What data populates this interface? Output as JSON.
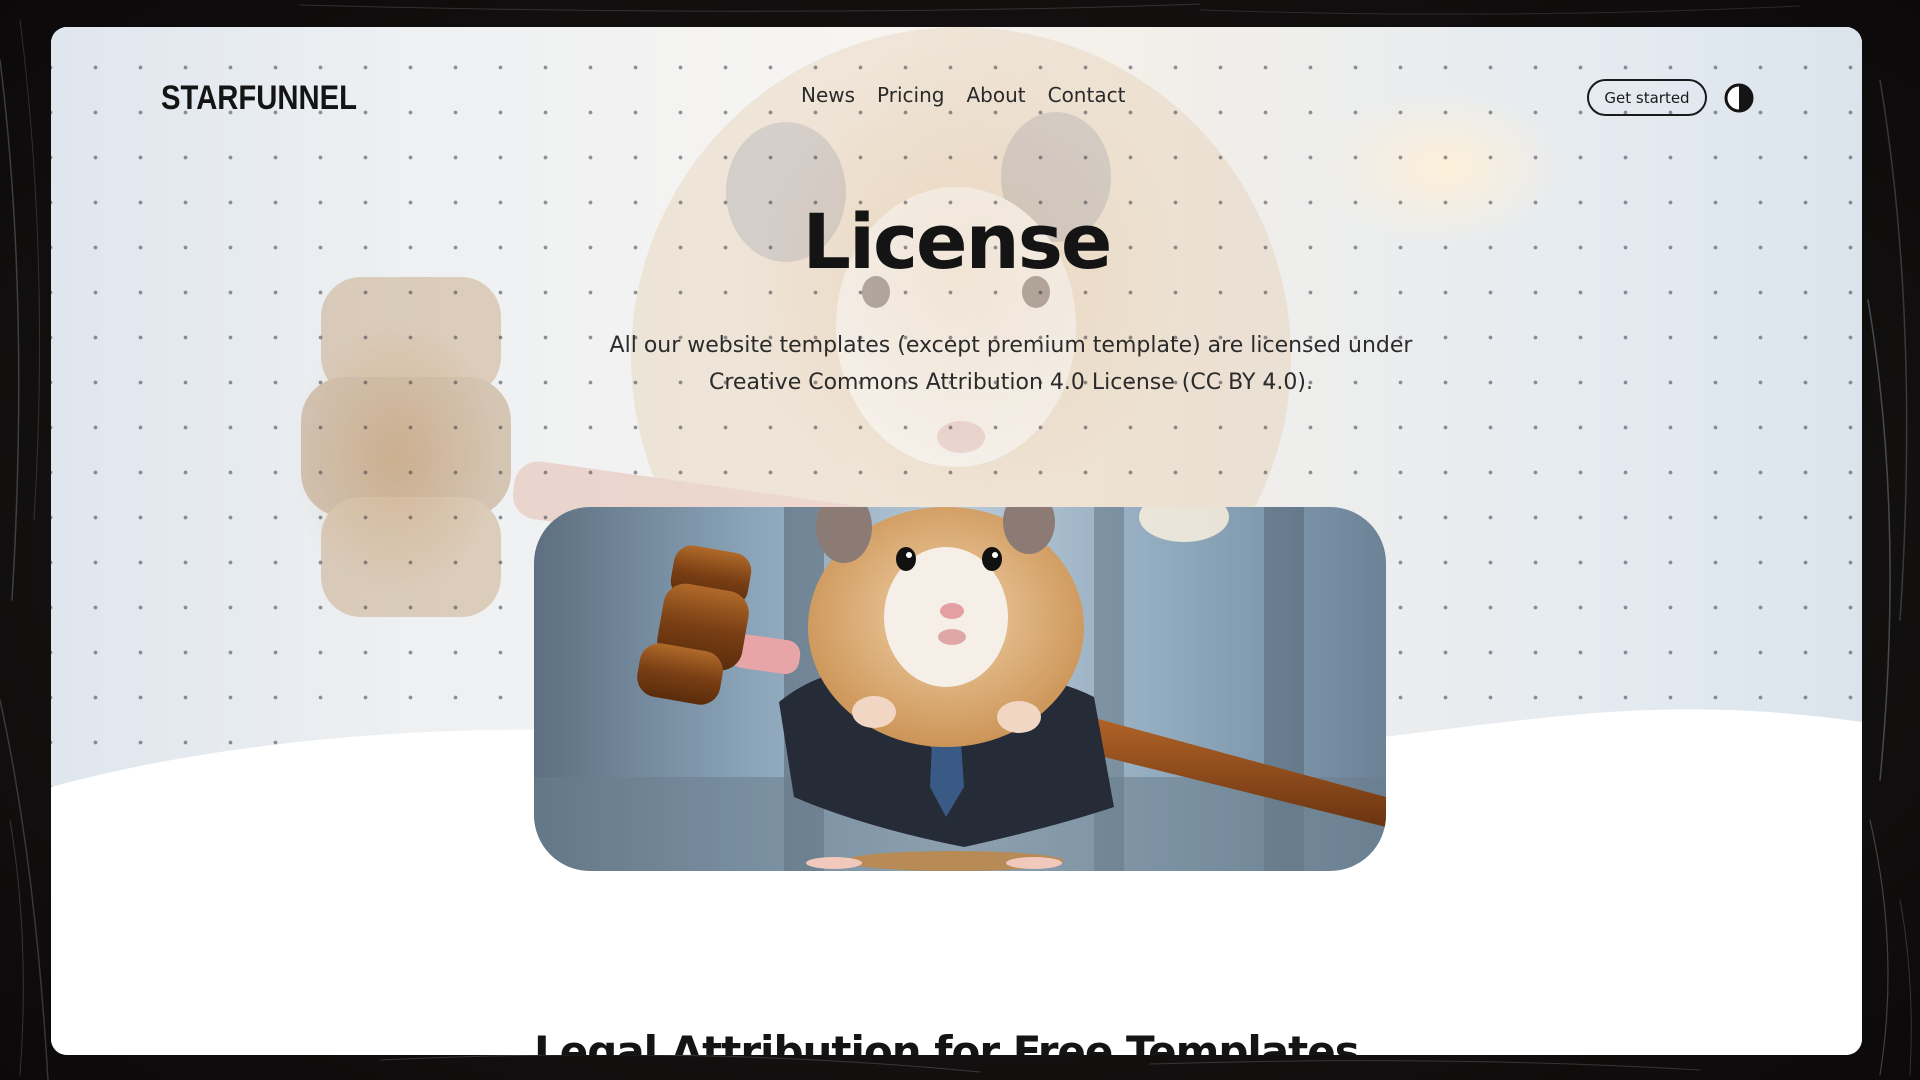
{
  "header": {
    "logo": "STARFUNNEL",
    "nav": [
      "News",
      "Pricing",
      "About",
      "Contact"
    ],
    "cta_label": "Get started",
    "theme_toggle_icon": "half-circle-contrast-icon"
  },
  "hero": {
    "title": "License",
    "subtitle": "All our website templates (except premium template) are licensed under Creative Commons Attribution 4.0 License (CC BY 4.0).",
    "image_icon": "hamster-judge-with-gavel-image"
  },
  "section": {
    "heading": "Legal Attribution for Free Templates"
  },
  "colors": {
    "text": "#141414",
    "page": "#ffffff",
    "backdrop": "#151212"
  }
}
